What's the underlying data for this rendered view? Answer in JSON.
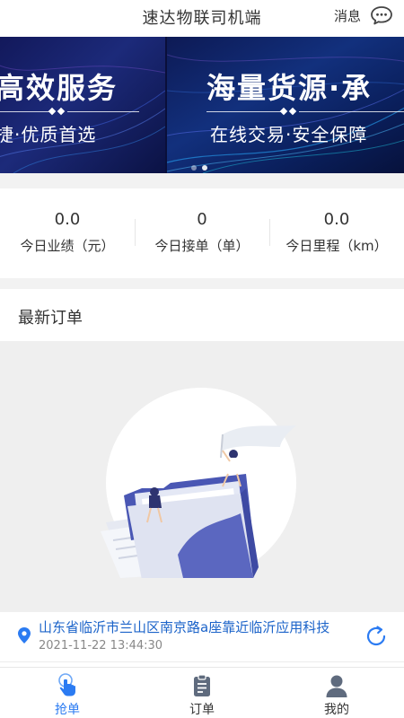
{
  "header": {
    "title": "速达物联司机端",
    "message_label": "消息"
  },
  "banner": {
    "slides": [
      {
        "title": "高效服务",
        "subtitle": "捷·优质首选"
      },
      {
        "title": "海量货源·承",
        "subtitle": "在线交易·安全保障"
      }
    ],
    "active_index": 1,
    "slide_count": 2
  },
  "stats": [
    {
      "value": "0.0",
      "label": "今日业绩（元）"
    },
    {
      "value": "0",
      "label": "今日接单（单）"
    },
    {
      "value": "0.0",
      "label": "今日里程（km）"
    }
  ],
  "latest_orders": {
    "title": "最新订单",
    "order": {
      "address": "山东省临沂市兰山区南京路a座靠近临沂应用科技",
      "time": "2021-11-22 13:44:30"
    }
  },
  "tabbar": {
    "tabs": [
      {
        "label": "抢单",
        "icon": "tap-hand-icon",
        "active": true
      },
      {
        "label": "订单",
        "icon": "clipboard-icon",
        "active": false
      },
      {
        "label": "我的",
        "icon": "user-icon",
        "active": false
      }
    ]
  },
  "colors": {
    "accent": "#2b7bf2",
    "address": "#1b63c9",
    "illustration_primary": "#4a57b4",
    "background_gray": "#efefef"
  }
}
